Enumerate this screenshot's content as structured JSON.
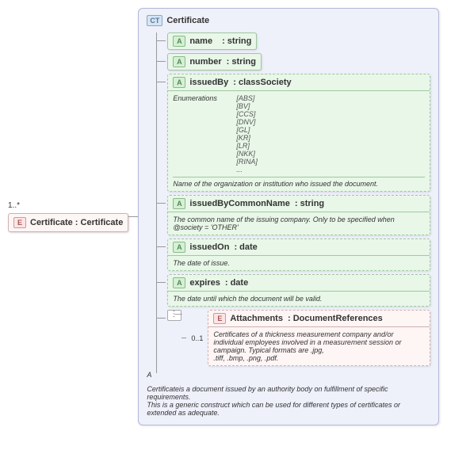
{
  "root": {
    "cardinality": "1..*",
    "element_name": "Certificate",
    "element_type": ": Certificate"
  },
  "complexType": {
    "name": "Certificate",
    "attributes": [
      {
        "name": "name",
        "type": ": string"
      },
      {
        "name": "number",
        "type": ": string"
      },
      {
        "name": "issuedBy",
        "type": ": classSociety",
        "enum_label": "Enumerations",
        "enum_values": "[ABS]\n[BV]\n[CCS]\n[DNV]\n[GL]\n[KR]\n[LR]\n[NKK]\n[RINA]\n...",
        "desc": "Name of the organization or institution who issued the document."
      },
      {
        "name": "issuedByCommonName",
        "type": ": string",
        "desc": "The common name of the issuing company. Only to be specified when @society = 'OTHER'"
      },
      {
        "name": "issuedOn",
        "type": ": date",
        "desc": "The date of issue."
      },
      {
        "name": "expires",
        "type": ": date",
        "desc": "The date until which the document will be valid."
      }
    ],
    "attachments": {
      "cardinality": "0..1",
      "name": "Attachments",
      "type": ": DocumentReferences",
      "desc": "Certificates of a thickness measurement company and/or individual employees involved in a measurement session or campaign. Typical formats are .jpg,\n.tiff, .bmp, .png, .pdf."
    },
    "annotation_marker": "A",
    "annotation": "Certificateis a document issued by an authority body on fulfillment of specific requirements.\nThis is a generic construct which can be used for different types of certificates or extended as adequate."
  }
}
